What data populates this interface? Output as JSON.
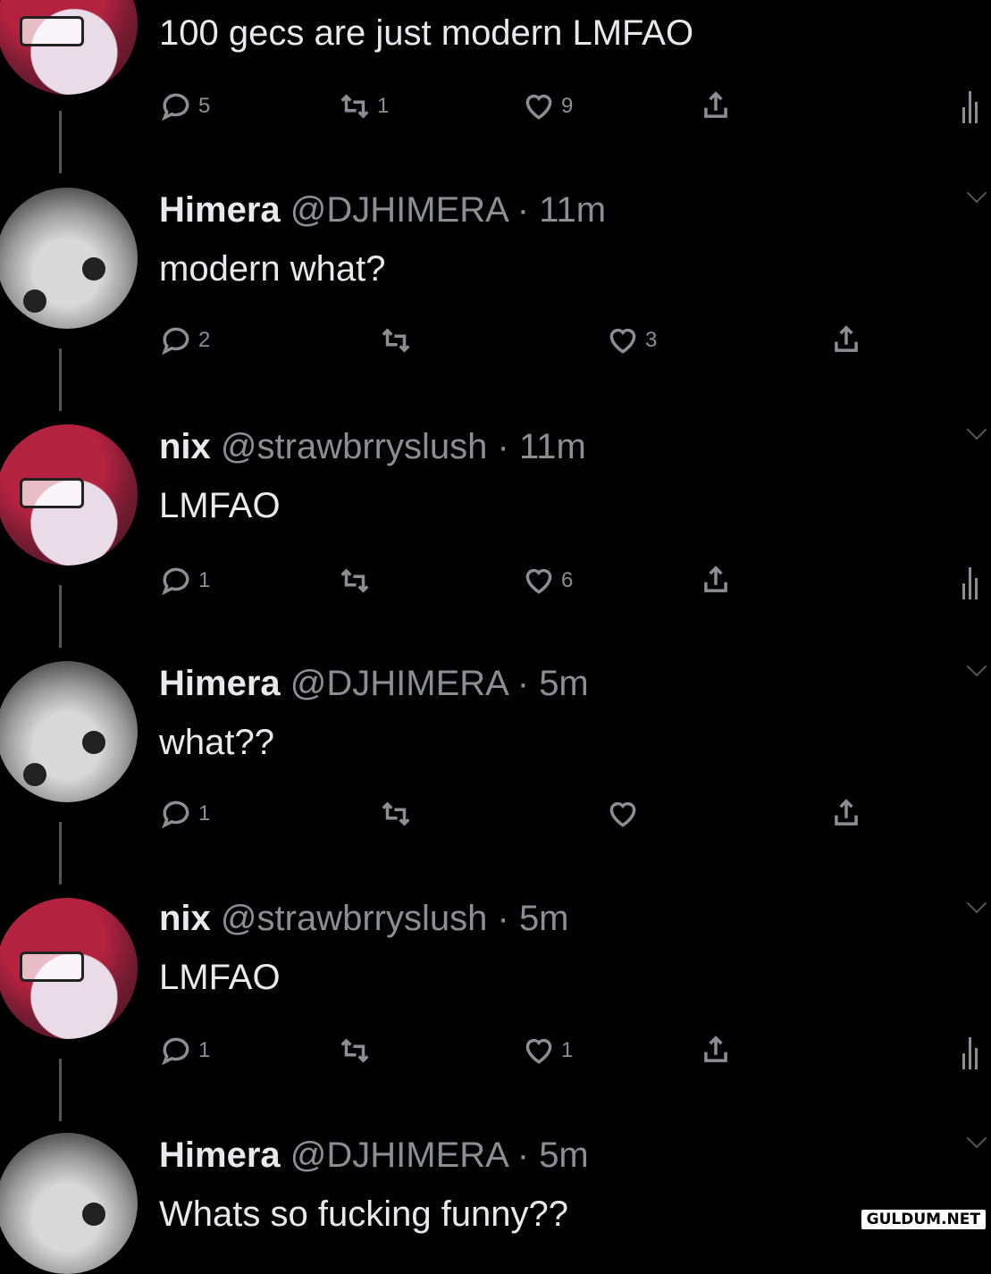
{
  "tweets": [
    {
      "avatar": "nix-avatar",
      "name": "",
      "handle": "",
      "time": "",
      "text": "100 gecs are just modern LMFAO",
      "replies": "5",
      "retweets": "1",
      "likes": "9",
      "show_analytics": true
    },
    {
      "avatar": "himera-avatar",
      "name": "Himera",
      "handle": "@DJHIMERA",
      "time": "11m",
      "text": "modern what?",
      "replies": "2",
      "retweets": "",
      "likes": "3",
      "show_analytics": false
    },
    {
      "avatar": "nix-avatar",
      "name": "nix",
      "handle": "@strawbrryslush",
      "time": "11m",
      "text": "LMFAO",
      "replies": "1",
      "retweets": "",
      "likes": "6",
      "show_analytics": true
    },
    {
      "avatar": "himera-avatar",
      "name": "Himera",
      "handle": "@DJHIMERA",
      "time": "5m",
      "text": "what??",
      "replies": "1",
      "retweets": "",
      "likes": "",
      "show_analytics": false
    },
    {
      "avatar": "nix-avatar",
      "name": "nix",
      "handle": "@strawbrryslush",
      "time": "5m",
      "text": "LMFAO",
      "replies": "1",
      "retweets": "",
      "likes": "1",
      "show_analytics": true
    },
    {
      "avatar": "himera-avatar",
      "name": "Himera",
      "handle": "@DJHIMERA",
      "time": "5m",
      "text": "Whats so fucking funny??",
      "replies": "",
      "retweets": "",
      "likes": "",
      "show_analytics": false
    }
  ],
  "separator": "·",
  "watermark": "GULDUM.NET",
  "colors": {
    "background": "#000000",
    "text": "#e7e9ea",
    "muted": "#8b8f94"
  },
  "icons": [
    "reply-icon",
    "retweet-icon",
    "like-icon",
    "share-icon",
    "analytics-icon"
  ]
}
